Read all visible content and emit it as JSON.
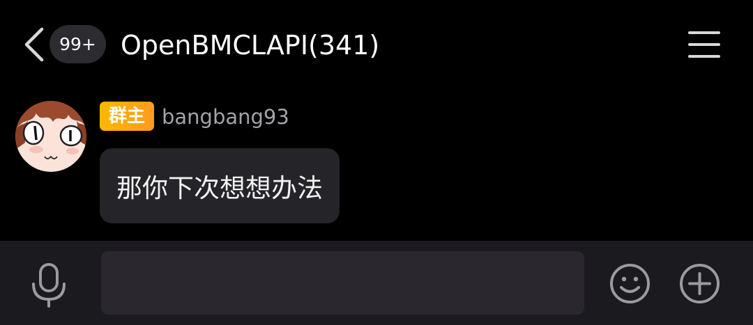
{
  "header": {
    "back_icon": "chevron-left-icon",
    "unread_count": "99+",
    "title": "OpenBMCLAPI(341)",
    "menu_icon": "hamburger-menu-icon"
  },
  "message": {
    "avatar_icon": "anime-face-avatar",
    "role_badge": "群主",
    "sender": "bangbang93",
    "text": "那你下次想想办法"
  },
  "input_bar": {
    "voice_icon": "microphone-icon",
    "input_value": "",
    "emoji_icon": "smiley-face-icon",
    "plus_icon": "plus-circle-icon"
  },
  "colors": {
    "background": "#000000",
    "bubble": "#252429",
    "input_bar": "#1b1a1f",
    "badge_gradient_start": "#ffb800",
    "badge_gradient_end": "#ff9a1e",
    "sender_name": "#a3a3a8"
  }
}
